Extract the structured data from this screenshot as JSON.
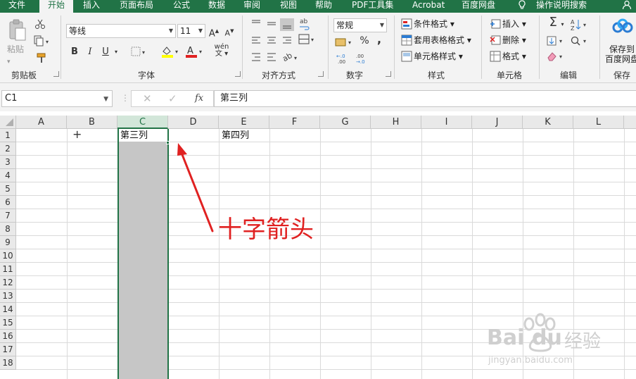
{
  "menu": {
    "tabs": [
      "文件",
      "开始",
      "插入",
      "页面布局",
      "公式",
      "数据",
      "审阅",
      "视图",
      "帮助",
      "PDF工具集",
      "Acrobat",
      "百度网盘"
    ],
    "tell_me": "操作说明搜索",
    "active": "开始"
  },
  "ribbon": {
    "clipboard": {
      "paste": "粘贴",
      "label": "剪贴板"
    },
    "font": {
      "name": "等线",
      "size": "11",
      "label": "字体",
      "bold": "B",
      "italic": "I",
      "underline": "U",
      "wen": "wén",
      "font_color_sample": "A"
    },
    "alignment": {
      "label": "对齐方式"
    },
    "number": {
      "format": "常规",
      "label": "数字",
      "percent": "%",
      "comma": ","
    },
    "styles": {
      "conditional": "条件格式",
      "table": "套用表格格式",
      "cell_styles": "单元格样式",
      "label": "样式"
    },
    "cells": {
      "insert": "插入",
      "delete": "删除",
      "format": "格式",
      "label": "单元格"
    },
    "editing": {
      "label": "编辑"
    },
    "save": {
      "line1": "保存到",
      "line2": "百度网盘",
      "label": "保存"
    }
  },
  "formula_bar": {
    "name_box": "C1",
    "fx": "fx",
    "value": "第三列"
  },
  "sheet": {
    "columns": [
      "A",
      "B",
      "C",
      "D",
      "E",
      "F",
      "G",
      "H",
      "I",
      "J",
      "K",
      "L"
    ],
    "rows": [
      "1",
      "2",
      "3",
      "4",
      "5",
      "6",
      "7",
      "8",
      "9",
      "10",
      "11",
      "12",
      "13",
      "14",
      "15",
      "16",
      "17",
      "18"
    ],
    "selected_column": "C",
    "cells": {
      "C1": "第三列",
      "E1": "第四列"
    },
    "cursor_glyph": "+"
  },
  "annotation": {
    "text": "十字箭头"
  },
  "watermark": {
    "brand_a": "Bai",
    "brand_b": "du",
    "brand_cn": "经验",
    "url": "jingyan.baidu.com"
  },
  "colors": {
    "excel_green": "#217346",
    "annotation_red": "#e02121",
    "selection_fill": "#c6c6c6"
  }
}
